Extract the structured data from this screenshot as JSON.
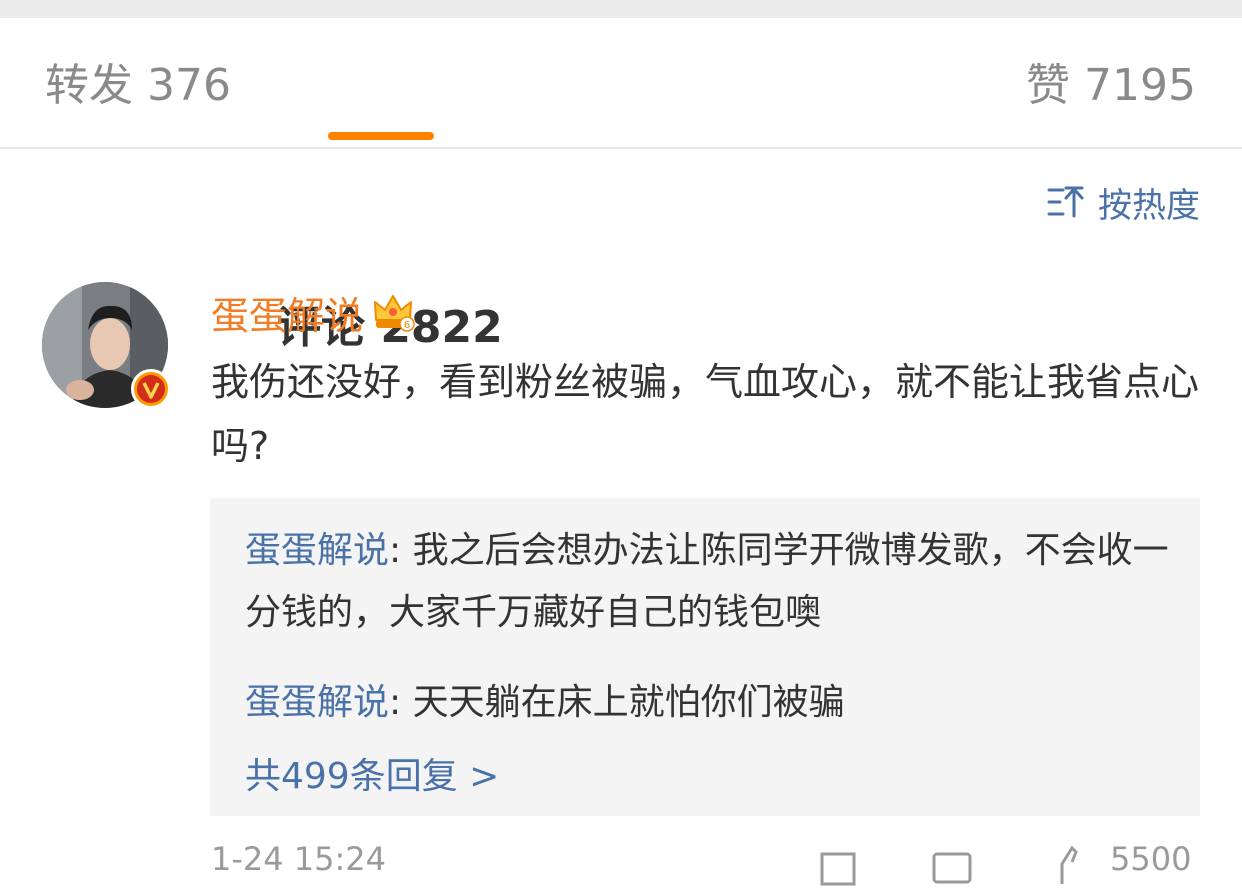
{
  "tabs": {
    "repost": "转发 376",
    "comment": "评论 2822",
    "like": "赞 7195"
  },
  "sort": {
    "label": "按热度"
  },
  "comment": {
    "username": "蛋蛋解说",
    "text": "我伤还没好，看到粉丝被骗，气血攻心，就不能让我省点心吗?",
    "replies": [
      {
        "name": "蛋蛋解说",
        "text": ": 我之后会想办法让陈同学开微博发歌，不会收一分钱的，大家千万藏好自己的钱包噢"
      },
      {
        "name": "蛋蛋解说",
        "text": ": 天天躺在床上就怕你们被骗"
      }
    ],
    "more_replies": "共499条回复 >",
    "time": "1-24 15:24",
    "likes": "5500"
  },
  "colors": {
    "accent": "#ff8200",
    "username": "#f37b22",
    "link": "#4a72a8",
    "text": "#333333",
    "muted": "#8a8a8a"
  }
}
